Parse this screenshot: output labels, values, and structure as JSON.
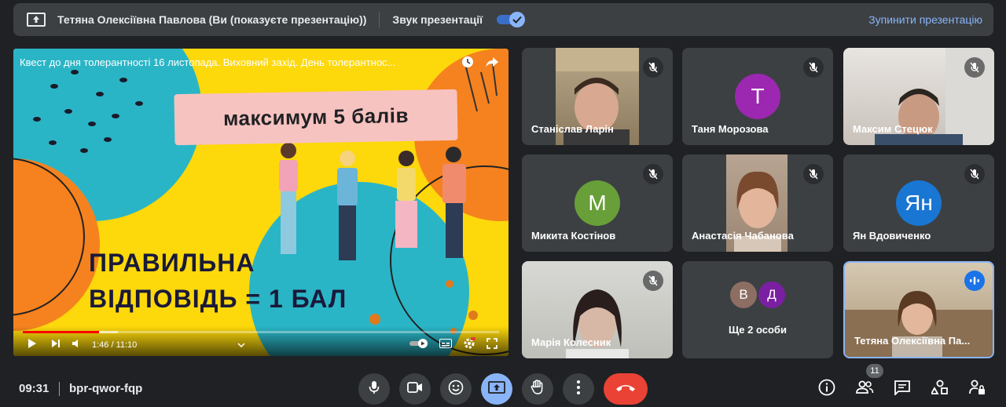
{
  "banner": {
    "presenter_text": "Тетяна Олексіївна Павлова (Ви (показуєте презентацію))",
    "sound_label": "Звук презентації",
    "sound_enabled": true,
    "stop_label": "Зупинити презентацію"
  },
  "presentation": {
    "video_title": "Квест до дня толерантності 16 листопада. Виховний захід. День толерантнос...",
    "slide_heading": "максимум 5 балів",
    "slide_answer_line1": "ПРАВИЛЬНА",
    "slide_answer_line2": "ВІДПОВІДЬ = 1 БАЛ",
    "time": "1:46 / 11:10",
    "progress": 0.16
  },
  "participants": [
    {
      "name": "Станіслав Ларін",
      "type": "video",
      "muted": true
    },
    {
      "name": "Таня Морозова",
      "type": "avatar",
      "initial": "Т",
      "color": "#9c27b0",
      "muted": true
    },
    {
      "name": "Максим Стецюк",
      "type": "video",
      "muted": true
    },
    {
      "name": "Микита Костінов",
      "type": "avatar",
      "initial": "М",
      "color": "#689f38",
      "muted": true
    },
    {
      "name": "Анастасія Чабанова",
      "type": "video",
      "muted": true
    },
    {
      "name": "Ян Вдовиченко",
      "type": "avatar",
      "initial": "Ян",
      "color": "#1976d2",
      "muted": true
    },
    {
      "name": "Марія Колесник",
      "type": "video",
      "muted": true
    },
    {
      "name": "Тетяна Олексіївна Па...",
      "type": "video",
      "speaking": true
    }
  ],
  "more_tile": {
    "label": "Ще 2 особи",
    "initials": [
      "В",
      "Д"
    ],
    "colors": [
      "#8d6e63",
      "#7b1fa2"
    ]
  },
  "bottom_bar": {
    "time": "09:31",
    "meeting_code": "bpr-qwor-fqp",
    "participant_count": "11"
  }
}
